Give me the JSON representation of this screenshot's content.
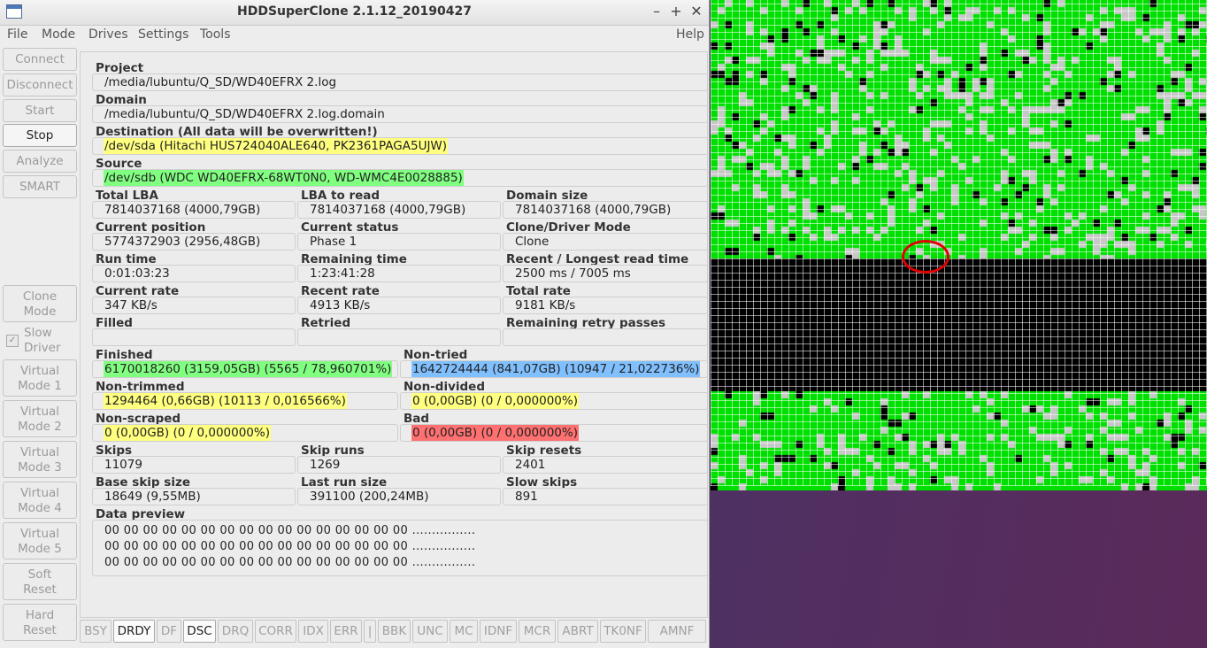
{
  "window": {
    "title": "HDDSuperClone 2.1.12_20190427"
  },
  "menu": {
    "file": "File",
    "mode": "Mode",
    "drives": "Drives",
    "settings": "Settings",
    "tools": "Tools",
    "help": "Help"
  },
  "sidebar": {
    "connect": "Connect",
    "disconnect": "Disconnect",
    "start": "Start",
    "stop": "Stop",
    "analyze": "Analyze",
    "smart": "SMART",
    "clone_mode": [
      "Clone",
      "Mode"
    ],
    "slow_driver": [
      "Slow",
      "Driver"
    ],
    "virtual_mode_1": [
      "Virtual",
      "Mode 1"
    ],
    "virtual_mode_2": [
      "Virtual",
      "Mode 2"
    ],
    "virtual_mode_3": [
      "Virtual",
      "Mode 3"
    ],
    "virtual_mode_4": [
      "Virtual",
      "Mode 4"
    ],
    "virtual_mode_5": [
      "Virtual",
      "Mode 5"
    ],
    "soft_reset": [
      "Soft",
      "Reset"
    ],
    "hard_reset": [
      "Hard",
      "Reset"
    ]
  },
  "fields": {
    "project": {
      "label": "Project",
      "value": "/media/lubuntu/Q_SD/WD40EFRX 2.log"
    },
    "domain": {
      "label": "Domain",
      "value": "/media/lubuntu/Q_SD/WD40EFRX 2.log.domain"
    },
    "destination": {
      "label": "Destination (All data will be overwritten!)",
      "value": "/dev/sda (Hitachi HUS724040ALE640, PK2361PAGA5UJW)"
    },
    "source": {
      "label": "Source",
      "value": "/dev/sdb (WDC WD40EFRX-68WT0N0, WD-WMC4E0028885)"
    },
    "total_lba": {
      "label": "Total LBA",
      "value": "7814037168 (4000,79GB)"
    },
    "lba_to_read": {
      "label": "LBA to read",
      "value": "7814037168 (4000,79GB)"
    },
    "domain_size": {
      "label": "Domain size",
      "value": "7814037168 (4000,79GB)"
    },
    "current_position": {
      "label": "Current position",
      "value": "5774372903 (2956,48GB)"
    },
    "current_status": {
      "label": "Current status",
      "value": "Phase 1"
    },
    "clone_driver_mode": {
      "label": "Clone/Driver Mode",
      "value": "Clone"
    },
    "run_time": {
      "label": "Run time",
      "value": "0:01:03:23"
    },
    "remaining_time": {
      "label": "Remaining time",
      "value": "1:23:41:28"
    },
    "recent_longest_read_time": {
      "label": "Recent / Longest read time",
      "value": "2500 ms / 7005 ms"
    },
    "current_rate": {
      "label": "Current rate",
      "value": "347 KB/s"
    },
    "recent_rate": {
      "label": "Recent rate",
      "value": "4913 KB/s"
    },
    "total_rate": {
      "label": "Total rate",
      "value": "9181 KB/s"
    },
    "filled": {
      "label": "Filled",
      "value": ""
    },
    "retried": {
      "label": "Retried",
      "value": ""
    },
    "remaining_retry_passes": {
      "label": "Remaining retry passes",
      "value": ""
    },
    "finished": {
      "label": "Finished",
      "value": "6170018260 (3159,05GB) (5565 / 78,960701%)"
    },
    "non_tried": {
      "label": "Non-tried",
      "value": "1642724444 (841,07GB) (10947 / 21,022736%)"
    },
    "non_trimmed": {
      "label": "Non-trimmed",
      "value": "1294464 (0,66GB) (10113 / 0,016566%)"
    },
    "non_divided": {
      "label": "Non-divided",
      "value": "0 (0,00GB) (0 / 0,000000%)"
    },
    "non_scraped": {
      "label": "Non-scraped",
      "value": "0 (0,00GB) (0 / 0,000000%)"
    },
    "bad": {
      "label": "Bad",
      "value": "0 (0,00GB) (0 / 0,000000%)"
    },
    "skips": {
      "label": "Skips",
      "value": "11079"
    },
    "skip_runs": {
      "label": "Skip runs",
      "value": "1269"
    },
    "skip_resets": {
      "label": "Skip resets",
      "value": "2401"
    },
    "base_skip_size": {
      "label": "Base skip size",
      "value": "18649 (9,55MB)"
    },
    "last_run_size": {
      "label": "Last run size",
      "value": "391100 (200,24MB)"
    },
    "slow_skips": {
      "label": "Slow skips",
      "value": "891"
    }
  },
  "data_preview": {
    "label": "Data preview",
    "lines": [
      "00 00 00 00 00 00 00 00 00 00 00 00 00 00 00 00 ................",
      "00 00 00 00 00 00 00 00 00 00 00 00 00 00 00 00 ................",
      "00 00 00 00 00 00 00 00 00 00 00 00 00 00 00 00 ................"
    ]
  },
  "status_flags": [
    {
      "label": "BSY",
      "active": false
    },
    {
      "label": "DRDY",
      "active": true
    },
    {
      "label": "DF",
      "active": false
    },
    {
      "label": "DSC",
      "active": true
    },
    {
      "label": "DRQ",
      "active": false
    },
    {
      "label": "CORR",
      "active": false
    },
    {
      "label": "IDX",
      "active": false
    },
    {
      "label": "ERR",
      "active": false
    },
    {
      "label": "|",
      "active": false
    },
    {
      "label": "BBK",
      "active": false
    },
    {
      "label": "UNC",
      "active": false
    },
    {
      "label": "MC",
      "active": false
    },
    {
      "label": "IDNF",
      "active": false
    },
    {
      "label": "MCR",
      "active": false
    },
    {
      "label": "ABRT",
      "active": false
    },
    {
      "label": "TK0NF",
      "active": false
    },
    {
      "label": "AMNF",
      "active": false
    }
  ],
  "colors": {
    "finished": "#80ff80",
    "non_tried": "#80c0ff",
    "yellow_status": "#ffff80",
    "bad": "#ff7070",
    "map_finished": "#00e000",
    "map_non_tried": "#c8c8c8",
    "map_non_trimmed": "#000000",
    "marker": "#e00000"
  },
  "block_map": {
    "description_icon": "sector-map",
    "marker": "red-circle-annotation"
  }
}
